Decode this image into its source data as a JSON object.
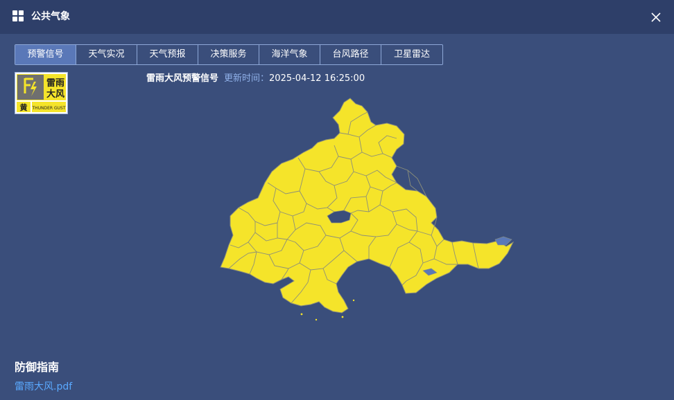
{
  "window": {
    "title": "公共气象",
    "icon": "grid-icon",
    "close_icon": "close-icon"
  },
  "tabs": [
    {
      "label": "预警信号",
      "active": true
    },
    {
      "label": "天气实况",
      "active": false
    },
    {
      "label": "天气预报",
      "active": false
    },
    {
      "label": "决策服务",
      "active": false
    },
    {
      "label": "海洋气象",
      "active": false
    },
    {
      "label": "台风路径",
      "active": false
    },
    {
      "label": "卫星雷达",
      "active": false
    }
  ],
  "warning": {
    "badge_icon": "thunder-gust-warning-icon",
    "badge_text_top": "雷雨",
    "badge_text_mid": "大风",
    "badge_level": "黄",
    "badge_english": "THUNDER GUST",
    "signal_name": "雷雨大风预警信号",
    "update_label": "更新时间：",
    "update_time": "2025-04-12 16:25:00",
    "map_color": "#f5e42a",
    "border_color": "#8c8f7a"
  },
  "guide": {
    "title": "防御指南",
    "link_text": "雷雨大风.pdf"
  },
  "colors": {
    "background": "#3a4e7b",
    "titlebar": "#2e3f69",
    "tab_active": "#5a78b8",
    "link": "#5aa9ff"
  }
}
